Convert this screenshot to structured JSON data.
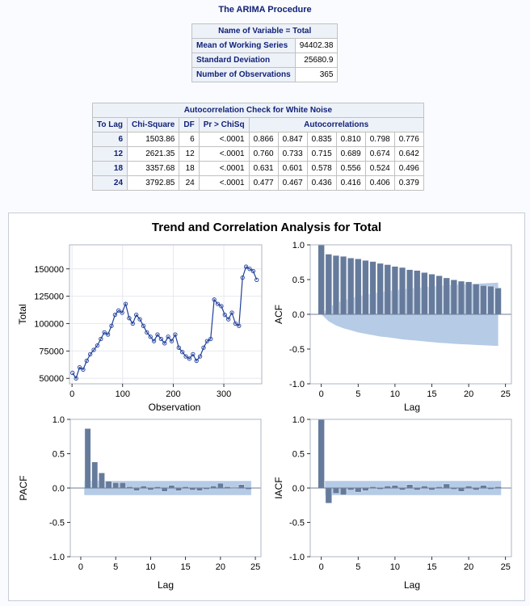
{
  "procedure_title": "The ARIMA Procedure",
  "variable_table": {
    "header": "Name of Variable = Total",
    "rows": [
      {
        "label": "Mean of Working Series",
        "value": "94402.38"
      },
      {
        "label": "Standard Deviation",
        "value": "25680.9"
      },
      {
        "label": "Number of Observations",
        "value": "365"
      }
    ]
  },
  "white_noise_table": {
    "title": "Autocorrelation Check for White Noise",
    "columns": [
      "To Lag",
      "Chi-Square",
      "DF",
      "Pr > ChiSq",
      "Autocorrelations"
    ],
    "rows": [
      {
        "lag": "6",
        "chisq": "1503.86",
        "df": "6",
        "p": "<.0001",
        "ac": [
          "0.866",
          "0.847",
          "0.835",
          "0.810",
          "0.798",
          "0.776"
        ]
      },
      {
        "lag": "12",
        "chisq": "2621.35",
        "df": "12",
        "p": "<.0001",
        "ac": [
          "0.760",
          "0.733",
          "0.715",
          "0.689",
          "0.674",
          "0.642"
        ]
      },
      {
        "lag": "18",
        "chisq": "3357.68",
        "df": "18",
        "p": "<.0001",
        "ac": [
          "0.631",
          "0.601",
          "0.578",
          "0.556",
          "0.524",
          "0.496"
        ]
      },
      {
        "lag": "24",
        "chisq": "3792.85",
        "df": "24",
        "p": "<.0001",
        "ac": [
          "0.477",
          "0.467",
          "0.436",
          "0.416",
          "0.406",
          "0.379"
        ]
      }
    ]
  },
  "panel_title": "Trend and Correlation Analysis for Total",
  "colors": {
    "bar": "#667b9c",
    "band": "#b5cbe6",
    "series": "#1f3f9a",
    "header_text": "#112277",
    "header_bg": "#edf2f9"
  },
  "chart_data": [
    {
      "type": "line",
      "xlabel": "Observation",
      "ylabel": "Total",
      "xlim": [
        -5,
        375
      ],
      "ylim": [
        45000,
        172000
      ],
      "xticks": [
        0,
        100,
        200,
        300
      ],
      "yticks": [
        50000,
        75000,
        100000,
        125000,
        150000
      ],
      "series": [
        {
          "marker": "circle",
          "x": [
            1,
            8,
            15,
            22,
            29,
            36,
            43,
            50,
            57,
            64,
            71,
            78,
            85,
            92,
            99,
            106,
            113,
            120,
            127,
            134,
            141,
            148,
            155,
            162,
            169,
            176,
            183,
            190,
            197,
            204,
            211,
            218,
            225,
            232,
            239,
            246,
            253,
            260,
            267,
            274,
            281,
            288,
            295,
            302,
            309,
            316,
            323,
            330,
            337,
            344,
            351,
            358,
            365
          ],
          "y": [
            55000,
            50000,
            60000,
            58000,
            66000,
            72000,
            76000,
            80000,
            86000,
            92000,
            90000,
            98000,
            108000,
            112000,
            110000,
            118000,
            105000,
            100000,
            108000,
            104000,
            98000,
            92000,
            88000,
            84000,
            90000,
            86000,
            82000,
            88000,
            84000,
            90000,
            78000,
            74000,
            70000,
            68000,
            72000,
            66000,
            70000,
            78000,
            84000,
            86000,
            122000,
            118000,
            116000,
            108000,
            104000,
            110000,
            100000,
            98000,
            142000,
            152000,
            150000,
            148000,
            140000
          ]
        }
      ]
    },
    {
      "type": "bar",
      "xlabel": "Lag",
      "ylabel": "ACF",
      "xlim": [
        -1.5,
        25.8
      ],
      "ylim": [
        -1.0,
        1.0
      ],
      "xticks": [
        0,
        5,
        10,
        15,
        20,
        25
      ],
      "yticks": [
        -1.0,
        -0.5,
        0.0,
        0.5,
        1.0
      ],
      "lags": [
        0,
        1,
        2,
        3,
        4,
        5,
        6,
        7,
        8,
        9,
        10,
        11,
        12,
        13,
        14,
        15,
        16,
        17,
        18,
        19,
        20,
        21,
        22,
        23,
        24
      ],
      "values": [
        1.0,
        0.866,
        0.847,
        0.835,
        0.81,
        0.798,
        0.776,
        0.76,
        0.733,
        0.715,
        0.689,
        0.674,
        0.642,
        0.631,
        0.601,
        0.578,
        0.556,
        0.524,
        0.496,
        0.477,
        0.467,
        0.436,
        0.416,
        0.406,
        0.379
      ],
      "band_type": "growing",
      "band_limits": [
        0.0,
        0.1,
        0.16,
        0.2,
        0.23,
        0.26,
        0.28,
        0.3,
        0.32,
        0.33,
        0.345,
        0.36,
        0.37,
        0.38,
        0.39,
        0.4,
        0.41,
        0.415,
        0.425,
        0.43,
        0.435,
        0.44,
        0.445,
        0.45,
        0.455
      ]
    },
    {
      "type": "bar",
      "xlabel": "Lag",
      "ylabel": "PACF",
      "xlim": [
        -1.5,
        25.8
      ],
      "ylim": [
        -1.0,
        1.0
      ],
      "xticks": [
        0,
        5,
        10,
        15,
        20,
        25
      ],
      "yticks": [
        -1.0,
        -0.5,
        0.0,
        0.5,
        1.0
      ],
      "lags": [
        1,
        2,
        3,
        4,
        5,
        6,
        7,
        8,
        9,
        10,
        11,
        12,
        13,
        14,
        15,
        16,
        17,
        18,
        19,
        20,
        21,
        22,
        23,
        24
      ],
      "values": [
        0.866,
        0.38,
        0.22,
        0.1,
        0.08,
        0.08,
        0.02,
        -0.04,
        0.03,
        -0.03,
        0.02,
        -0.05,
        0.04,
        -0.04,
        0.02,
        -0.03,
        -0.04,
        -0.02,
        0.03,
        0.07,
        0.02,
        -0.01,
        0.05,
        -0.02
      ],
      "band_type": "constant",
      "band_lim": 0.103,
      "band_range": [
        1,
        24
      ]
    },
    {
      "type": "bar",
      "xlabel": "Lag",
      "ylabel": "IACF",
      "xlim": [
        -1.5,
        25.8
      ],
      "ylim": [
        -1.0,
        1.0
      ],
      "xticks": [
        0,
        5,
        10,
        15,
        20,
        25
      ],
      "yticks": [
        -1.0,
        -0.5,
        0.0,
        0.5,
        1.0
      ],
      "lags": [
        0,
        1,
        2,
        3,
        4,
        5,
        6,
        7,
        8,
        9,
        10,
        11,
        12,
        13,
        14,
        15,
        16,
        17,
        18,
        19,
        20,
        21,
        22,
        23,
        24
      ],
      "values": [
        1.0,
        -0.22,
        -0.08,
        -0.1,
        -0.03,
        -0.06,
        -0.04,
        0.02,
        -0.02,
        0.03,
        0.04,
        -0.03,
        0.05,
        -0.03,
        0.03,
        -0.03,
        0.02,
        0.06,
        -0.02,
        -0.05,
        0.03,
        -0.03,
        0.04,
        -0.02,
        0.02
      ],
      "band_type": "constant",
      "band_lim": 0.103,
      "band_range": [
        1,
        24
      ]
    }
  ]
}
